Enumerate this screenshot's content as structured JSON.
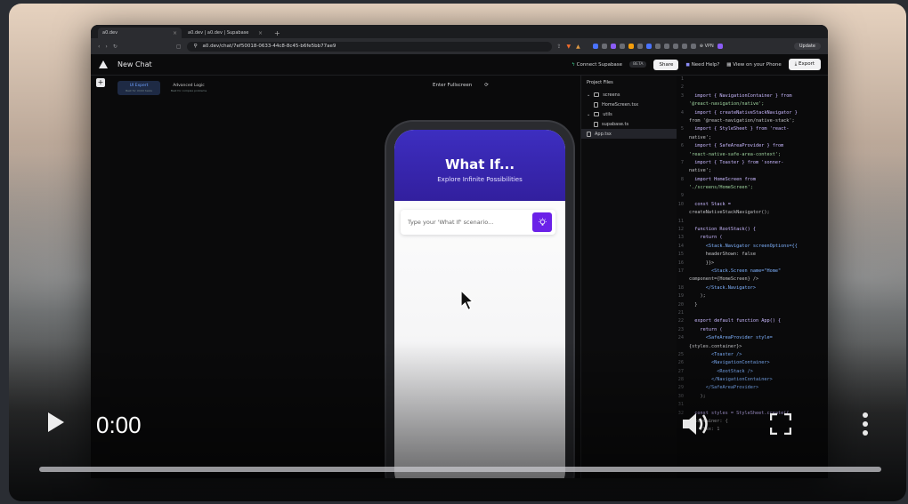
{
  "browser": {
    "tabs": [
      {
        "label": "a0.dev",
        "active": true
      },
      {
        "label": "a0.dev | a0.dev | Supabase",
        "active": false
      }
    ],
    "url": "a0.dev/chat/7ef50018-0633-44c8-8c45-b6fe5bb77ae9",
    "vpn_label": "⊕ VPN",
    "update_label": "Update"
  },
  "app": {
    "title": "New Chat",
    "connect_label": "Connect Supabase",
    "beta_label": "BETA",
    "share_label": "Share",
    "help_label": "Need Help?",
    "view_phone_label": "View on your Phone",
    "export_label": "Export"
  },
  "preview": {
    "modes": [
      {
        "label": "UI Expert",
        "sub": "Best for UI/UX tasks",
        "active": true
      },
      {
        "label": "Advanced Logic",
        "sub": "Best for complex problems",
        "active": false
      }
    ],
    "fullscreen_label": "Enter Fullscreen",
    "refresh_icon": "refresh-icon",
    "phone": {
      "hero_title": "What If...",
      "hero_subtitle": "Explore Infinite Possibilities",
      "input_placeholder": "Type your 'What If' scenario...",
      "accent": "#6b21e8",
      "hero_color": "#3d2ec0"
    }
  },
  "files": {
    "header": "Project Files",
    "items": [
      {
        "label": "screens",
        "type": "folder",
        "depth": 0
      },
      {
        "label": "HomeScreen.tsx",
        "type": "file",
        "depth": 1
      },
      {
        "label": "utils",
        "type": "folder",
        "depth": 0
      },
      {
        "label": "supabase.ts",
        "type": "file",
        "depth": 1
      },
      {
        "label": "App.tsx",
        "type": "file",
        "depth": 0,
        "selected": true
      }
    ]
  },
  "code": {
    "lines": [
      {
        "n": "1",
        "text": ""
      },
      {
        "n": "2",
        "text": ""
      },
      {
        "n": "3",
        "text": "  import { NavigationContainer } from"
      },
      {
        "n": "",
        "text": "'@react-navigation/native';"
      },
      {
        "n": "4",
        "text": "  import { createNativeStackNavigator }"
      },
      {
        "n": "",
        "text": "from '@react-navigation/native-stack';"
      },
      {
        "n": "5",
        "text": "  import { StyleSheet } from 'react-"
      },
      {
        "n": "",
        "text": "native';"
      },
      {
        "n": "6",
        "text": "  import { SafeAreaProvider } from"
      },
      {
        "n": "",
        "text": "'react-native-safe-area-context';"
      },
      {
        "n": "7",
        "text": "  import { Toaster } from 'sonner-"
      },
      {
        "n": "",
        "text": "native';"
      },
      {
        "n": "8",
        "text": "  import HomeScreen from"
      },
      {
        "n": "",
        "text": "'./screens/HomeScreen';"
      },
      {
        "n": "9",
        "text": ""
      },
      {
        "n": "10",
        "text": "  const Stack ="
      },
      {
        "n": "",
        "text": "createNativeStackNavigator();"
      },
      {
        "n": "11",
        "text": ""
      },
      {
        "n": "12",
        "text": "  function RootStack() {"
      },
      {
        "n": "13",
        "text": "    return ("
      },
      {
        "n": "14",
        "text": "      <Stack.Navigator screenOptions={{"
      },
      {
        "n": "15",
        "text": "      headerShown: false"
      },
      {
        "n": "16",
        "text": "      }}>"
      },
      {
        "n": "17",
        "text": "        <Stack.Screen name=\"Home\""
      },
      {
        "n": "",
        "text": "component={HomeScreen} />"
      },
      {
        "n": "18",
        "text": "      </Stack.Navigator>"
      },
      {
        "n": "19",
        "text": "    );"
      },
      {
        "n": "20",
        "text": "  }"
      },
      {
        "n": "21",
        "text": ""
      },
      {
        "n": "22",
        "text": "  export default function App() {"
      },
      {
        "n": "23",
        "text": "    return ("
      },
      {
        "n": "24",
        "text": "      <SafeAreaProvider style="
      },
      {
        "n": "",
        "text": "{styles.container}>"
      },
      {
        "n": "25",
        "text": "        <Toaster />"
      },
      {
        "n": "26",
        "text": "        <NavigationContainer>"
      },
      {
        "n": "27",
        "text": "          <RootStack />"
      },
      {
        "n": "28",
        "text": "        </NavigationContainer>"
      },
      {
        "n": "29",
        "text": "      </SafeAreaProvider>"
      },
      {
        "n": "30",
        "text": "    );"
      },
      {
        "n": "31",
        "text": ""
      },
      {
        "n": "32",
        "text": "  const styles = StyleSheet.create({"
      },
      {
        "n": "",
        "text": "  container: {"
      },
      {
        "n": "",
        "text": "    flex: 1"
      }
    ]
  },
  "video": {
    "time": "0:00",
    "progress": 0
  }
}
